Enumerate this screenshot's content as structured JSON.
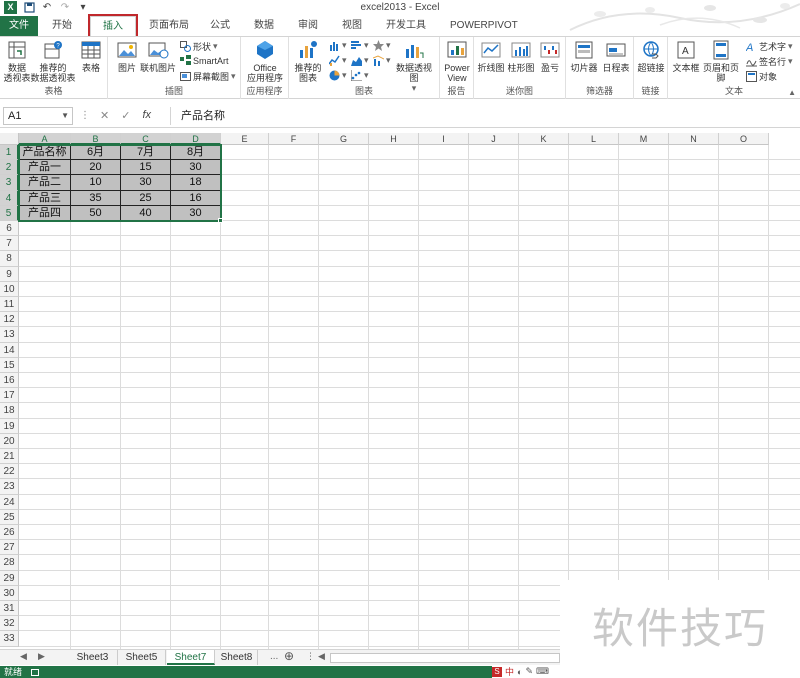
{
  "window": {
    "title": "excel2013 - Excel",
    "app_icon": "X",
    "accent": "#217346"
  },
  "qat": {
    "save_icon": "save-icon",
    "undo_icon": "undo-icon",
    "redo_icon": "redo-icon",
    "more_icon": "customize-icon"
  },
  "tabs": [
    {
      "label": "文件",
      "id": "file"
    },
    {
      "label": "开始",
      "id": "home"
    },
    {
      "label": "插入",
      "id": "insert"
    },
    {
      "label": "页面布局",
      "id": "page-layout"
    },
    {
      "label": "公式",
      "id": "formulas"
    },
    {
      "label": "数据",
      "id": "data"
    },
    {
      "label": "审阅",
      "id": "review"
    },
    {
      "label": "视图",
      "id": "view"
    },
    {
      "label": "开发工具",
      "id": "developer"
    },
    {
      "label": "POWERPIVOT",
      "id": "powerpivot"
    }
  ],
  "ribbon": {
    "tables": {
      "label": "表格",
      "pivot": "数据\n透视表",
      "recommended": "推荐的\n数据透视表",
      "table": "表格"
    },
    "illustrations": {
      "label": "插图",
      "pictures": "图片",
      "online": "联机图片",
      "shapes": "形状",
      "smartart": "SmartArt",
      "screenshot": "屏幕截图"
    },
    "apps": {
      "label": "应用程序",
      "office": "Office\n应用程序"
    },
    "charts": {
      "label": "图表",
      "recommended": "推荐的\n图表",
      "pivotchart": "数据透视图"
    },
    "reports": {
      "label": "报告",
      "power_view": "Power\nView"
    },
    "sparklines": {
      "label": "迷你图",
      "line": "折线图",
      "column": "柱形图",
      "winloss": "盈亏"
    },
    "filters": {
      "label": "筛选器",
      "slicer": "切片器",
      "timeline": "日程表"
    },
    "links": {
      "label": "链接",
      "hyperlink": "超链接"
    },
    "text": {
      "label": "文本",
      "textbox": "文本框",
      "header": "页眉和页脚",
      "wordart": "艺术字",
      "signature": "签名行",
      "object": "对象"
    }
  },
  "formula_bar": {
    "name_box": "A1",
    "cancel": "✕",
    "enter": "✓",
    "fx": "fx",
    "content": "产品名称"
  },
  "columns": [
    "A",
    "B",
    "C",
    "D",
    "E",
    "F",
    "G",
    "H",
    "I",
    "J",
    "K",
    "L",
    "M",
    "N",
    "O"
  ],
  "rows": [
    "1",
    "2",
    "3",
    "4",
    "5",
    "6",
    "7",
    "8",
    "9",
    "10",
    "11",
    "12",
    "13",
    "14",
    "15",
    "16",
    "17",
    "18",
    "19",
    "20",
    "21",
    "22",
    "23",
    "24",
    "25",
    "26",
    "27",
    "28",
    "29",
    "30",
    "31",
    "32",
    "33"
  ],
  "table": {
    "header": [
      "产品名称",
      "6月",
      "7月",
      "8月"
    ],
    "rows": [
      [
        "产品一",
        "20",
        "15",
        "30"
      ],
      [
        "产品二",
        "10",
        "30",
        "18"
      ],
      [
        "产品三",
        "35",
        "25",
        "16"
      ],
      [
        "产品四",
        "50",
        "40",
        "30"
      ]
    ]
  },
  "sheets": [
    {
      "name": "Sheet3",
      "active": false
    },
    {
      "name": "Sheet5",
      "active": false
    },
    {
      "name": "Sheet7",
      "active": true
    },
    {
      "name": "Sheet8",
      "active": false
    }
  ],
  "sheet_more": "...",
  "status": {
    "ready": "就绪"
  },
  "ime": {
    "label": "中"
  },
  "watermark": "软件技巧"
}
